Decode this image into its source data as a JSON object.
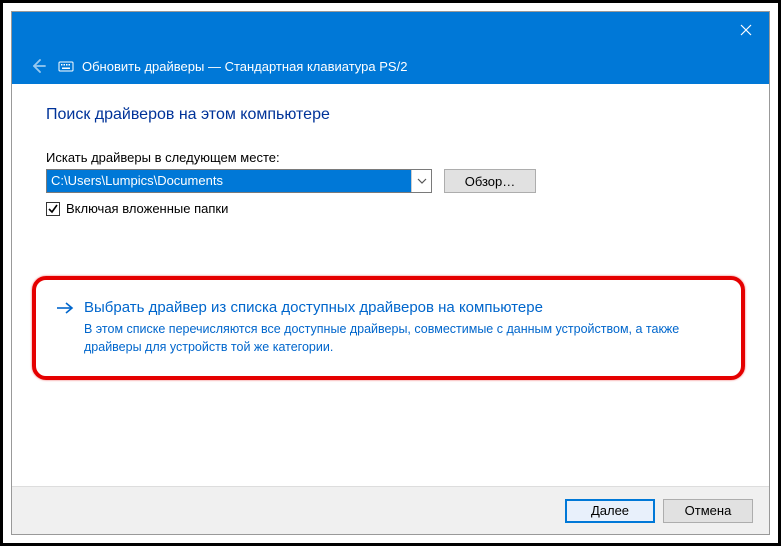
{
  "titlebar": {
    "close_tooltip": "Close"
  },
  "header": {
    "title": "Обновить драйверы — Стандартная клавиатура PS/2"
  },
  "page": {
    "heading": "Поиск драйверов на этом компьютере",
    "path_label": "Искать драйверы в следующем месте:",
    "path_value": "C:\\Users\\Lumpics\\Documents",
    "browse_label": "Обзор…",
    "include_subfolders_label": "Включая вложенные папки",
    "include_subfolders_checked": true,
    "choice": {
      "title": "Выбрать драйвер из списка доступных драйверов на компьютере",
      "description": "В этом списке перечисляются все доступные драйверы, совместимые с данным устройством, а также драйверы для устройств той же категории."
    }
  },
  "footer": {
    "next_label": "Далее",
    "cancel_label": "Отмена"
  }
}
